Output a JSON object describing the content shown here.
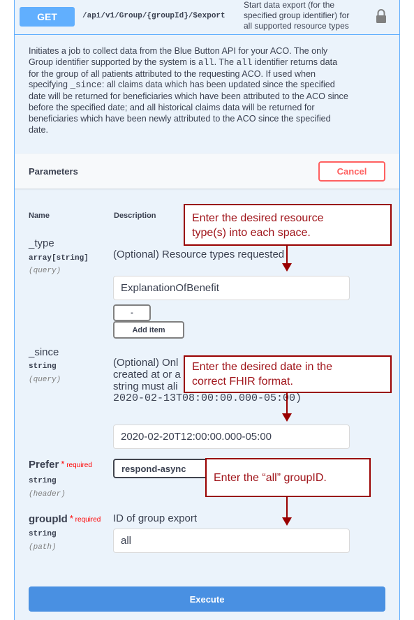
{
  "summary": {
    "method": "GET",
    "path": "/api/v1/Group/{groupId}/$export",
    "description_lines": [
      "Start data export (for the",
      "specified group identifier) for",
      "all supported resource types"
    ]
  },
  "icons": {
    "lock": "lock-icon"
  },
  "description": {
    "lines": [
      [
        {
          "t": "Initiates a job to collect data from the Blue Button API for your ACO. The only"
        }
      ],
      [
        {
          "t": "Group identifier supported by the system is "
        },
        {
          "c": "all"
        },
        {
          "t": ". The "
        },
        {
          "c": "all"
        },
        {
          "t": " identifier returns data"
        }
      ],
      [
        {
          "t": "for the group of all patients attributed to the requesting ACO. If used when"
        }
      ],
      [
        {
          "t": "specifying "
        },
        {
          "c": "_since"
        },
        {
          "t": ": all claims data which has been updated since the specified"
        }
      ],
      [
        {
          "t": "date will be returned for beneficiaries which have been attributed to the ACO since"
        }
      ],
      [
        {
          "t": "before the specified date; and all historical claims data will be returned for"
        }
      ],
      [
        {
          "t": "beneficiaries which have been newly attributed to the ACO since the specified"
        }
      ],
      [
        {
          "t": "date."
        }
      ]
    ]
  },
  "parameters": {
    "title": "Parameters",
    "cancel_label": "Cancel",
    "col_name": "Name",
    "col_description": "Description",
    "type_param": {
      "name": "_type",
      "type": "array[string]",
      "in": "(query)",
      "description": "(Optional) Resource types requested",
      "value": "ExplanationOfBenefit",
      "remove_label": "-",
      "add_label": "Add item"
    },
    "since_param": {
      "name": "_since",
      "type": "string",
      "in": "(query)",
      "desc_line1": "(Optional) Onl",
      "desc_line2": "created at or a",
      "desc_line3": "string must ali",
      "desc_line4": "2020-02-13T08:00:00.000-05:00)",
      "value": "2020-02-20T12:00:00.000-05:00"
    },
    "prefer_param": {
      "name": "Prefer",
      "required_star": "*",
      "required_label": "required",
      "type": "string",
      "in": "(header)",
      "value": "respond-async"
    },
    "group_param": {
      "name": "groupId",
      "required_star": "*",
      "required_label": "required",
      "type": "string",
      "in": "(path)",
      "description": "ID of group export",
      "value": "all"
    }
  },
  "execute_label": "Execute",
  "callouts": {
    "type_hint_line1": "Enter the desired resource",
    "type_hint_line2": "type(s) into each space.",
    "date_hint_line1": "Enter the desired date in the",
    "date_hint_line2": "correct FHIR format.",
    "group_hint": "Enter the “all” groupID."
  },
  "colors": {
    "get_accent": "#61affe",
    "execute": "#4990e2",
    "cancel": "#ff6060",
    "callout": "#990000",
    "panel_bg": "#ebf3fb"
  }
}
